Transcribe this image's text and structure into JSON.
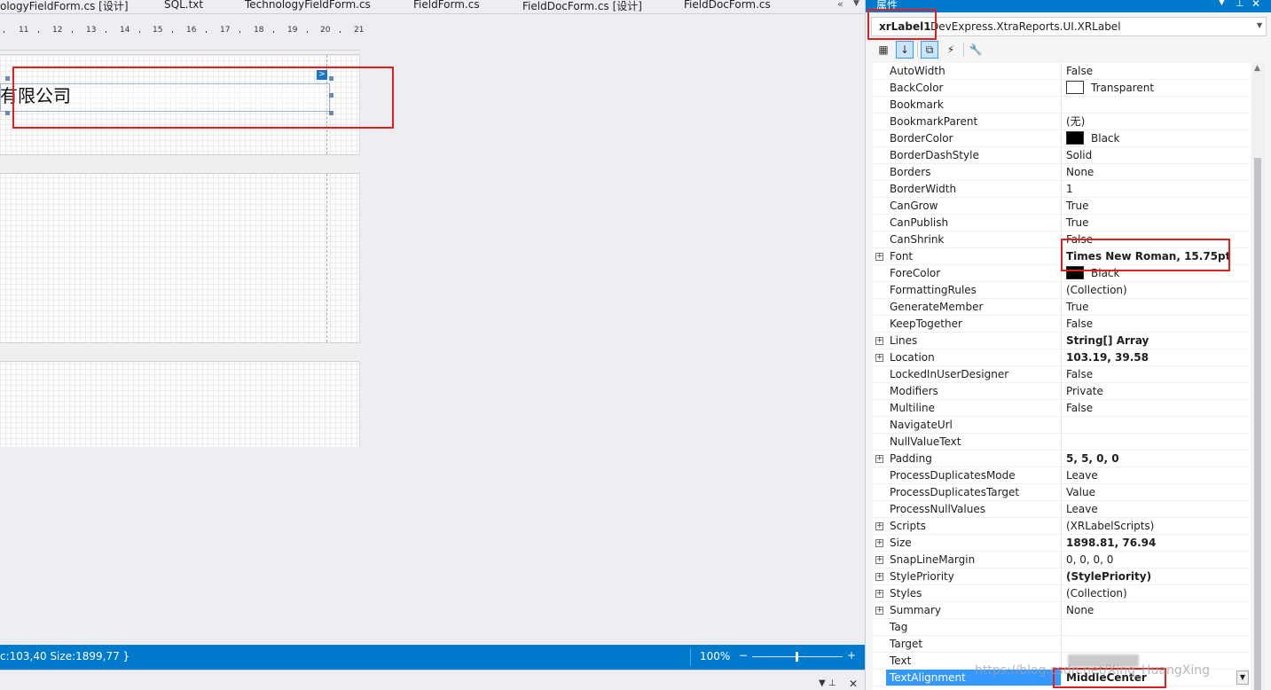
{
  "tabs": [
    "ologyFieldForm.cs [设计]",
    "SQL.txt",
    "TechnologyFieldForm.cs",
    "FieldForm.cs",
    "FieldDocForm.cs [设计]",
    "FieldDocForm.cs"
  ],
  "tab_controls": {
    "overflow": "«",
    "menu": "▼"
  },
  "ruler": [
    "11",
    "12",
    "13",
    "14",
    "15",
    "16",
    "17",
    "18",
    "19",
    "20",
    "21"
  ],
  "designer": {
    "label_text": "有限公司",
    "smart_tag": ">"
  },
  "status_bar": {
    "text": "c:103,40 Size:1899,77 }",
    "zoom": "100%",
    "zoom_minus": "−",
    "zoom_plus": "+",
    "zoom_level": 0.5
  },
  "bottom_strip": {
    "pin": "▼ ⊥",
    "close": "✕"
  },
  "properties_panel": {
    "title": "属性",
    "title_menu": "▼",
    "title_pin": "⊥",
    "title_close": "✕",
    "object_name": "xrLabel1",
    "object_type": "DevExpress.XtraReports.UI.XRLabel",
    "toolbar": [
      "▦",
      "↓",
      "⧉",
      "⚡",
      "🔧"
    ],
    "rows": [
      {
        "name": "AutoWidth",
        "value": "False"
      },
      {
        "name": "BackColor",
        "value": "Transparent",
        "swatch": "#ffffff"
      },
      {
        "name": "Bookmark",
        "value": ""
      },
      {
        "name": "BookmarkParent",
        "value": "(无)"
      },
      {
        "name": "BorderColor",
        "value": "Black",
        "swatch": "#000000"
      },
      {
        "name": "BorderDashStyle",
        "value": "Solid"
      },
      {
        "name": "Borders",
        "value": "None"
      },
      {
        "name": "BorderWidth",
        "value": "1"
      },
      {
        "name": "CanGrow",
        "value": "True"
      },
      {
        "name": "CanPublish",
        "value": "True"
      },
      {
        "name": "CanShrink",
        "value": "False"
      },
      {
        "name": "Font",
        "value": "Times New Roman, 15.75pt",
        "expandable": true,
        "bold": true
      },
      {
        "name": "ForeColor",
        "value": "Black",
        "swatch": "#000000"
      },
      {
        "name": "FormattingRules",
        "value": "(Collection)"
      },
      {
        "name": "GenerateMember",
        "value": "True"
      },
      {
        "name": "KeepTogether",
        "value": "False"
      },
      {
        "name": "Lines",
        "value": "String[] Array",
        "expandable": true,
        "bold": true
      },
      {
        "name": "Location",
        "value": "103.19, 39.58",
        "expandable": true,
        "bold": true
      },
      {
        "name": "LockedInUserDesigner",
        "value": "False"
      },
      {
        "name": "Modifiers",
        "value": "Private"
      },
      {
        "name": "Multiline",
        "value": "False"
      },
      {
        "name": "NavigateUrl",
        "value": ""
      },
      {
        "name": "NullValueText",
        "value": ""
      },
      {
        "name": "Padding",
        "value": "5, 5, 0, 0",
        "expandable": true,
        "bold": true
      },
      {
        "name": "ProcessDuplicatesMode",
        "value": "Leave"
      },
      {
        "name": "ProcessDuplicatesTarget",
        "value": "Value"
      },
      {
        "name": "ProcessNullValues",
        "value": "Leave"
      },
      {
        "name": "Scripts",
        "value": "(XRLabelScripts)",
        "expandable": true
      },
      {
        "name": "Size",
        "value": "1898.81, 76.94",
        "expandable": true,
        "bold": true
      },
      {
        "name": "SnapLineMargin",
        "value": "0, 0, 0, 0",
        "expandable": true
      },
      {
        "name": "StylePriority",
        "value": "(StylePriority)",
        "expandable": true,
        "bold": true
      },
      {
        "name": "Styles",
        "value": "(Collection)",
        "expandable": true
      },
      {
        "name": "Summary",
        "value": "None",
        "expandable": true
      },
      {
        "name": "Tag",
        "value": ""
      },
      {
        "name": "Target",
        "value": ""
      },
      {
        "name": "Text",
        "value": ""
      },
      {
        "name": "TextAlignment",
        "value": "MiddleCenter",
        "bold": true,
        "selected": true
      }
    ]
  },
  "watermark": "https://blog.csdn.net/Xing_HuangXing",
  "colors": {
    "accent": "#007acc",
    "highlight": "#e21f1f",
    "selection": "#3399ff"
  }
}
